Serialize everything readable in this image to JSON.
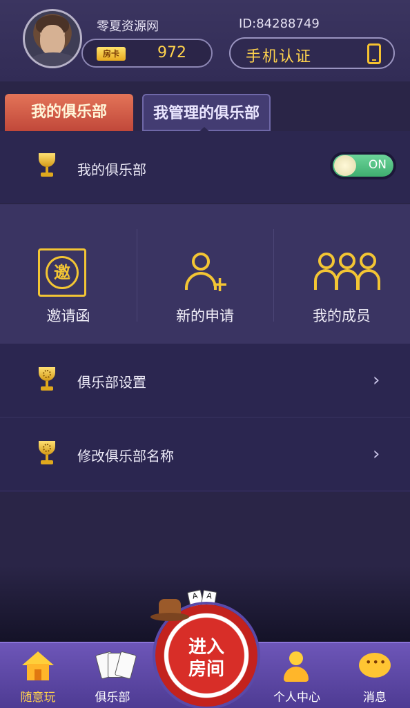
{
  "header": {
    "username": "零夏资源网",
    "user_id": "ID:84288749",
    "room_card_label": "房卡",
    "room_card_count": "972",
    "phone_verify_label": "手机认证"
  },
  "tabs": [
    {
      "label": "我的俱乐部",
      "active": false
    },
    {
      "label": "我管理的俱乐部",
      "active": true
    }
  ],
  "toggle": {
    "label": "我的俱乐部",
    "state": "ON"
  },
  "actions": [
    {
      "label": "邀请函",
      "icon": "invite-icon",
      "glyph": "邀"
    },
    {
      "label": "新的申请",
      "icon": "add-user-icon"
    },
    {
      "label": "我的成员",
      "icon": "members-icon"
    }
  ],
  "menu": [
    {
      "label": "俱乐部设置"
    },
    {
      "label": "修改俱乐部名称"
    }
  ],
  "enter_button": {
    "line1": "进入",
    "line2": "房间"
  },
  "cards_glyph": "A",
  "nav": [
    {
      "label": "随意玩",
      "active": true
    },
    {
      "label": "俱乐部",
      "active": false
    },
    {
      "label": "个人中心",
      "active": false
    },
    {
      "label": "消息",
      "active": false
    }
  ],
  "colors": {
    "accent_gold": "#f3c534",
    "background": "#2a2547",
    "active_tab": "#c1483a",
    "toggle_on": "#3fae6f"
  }
}
